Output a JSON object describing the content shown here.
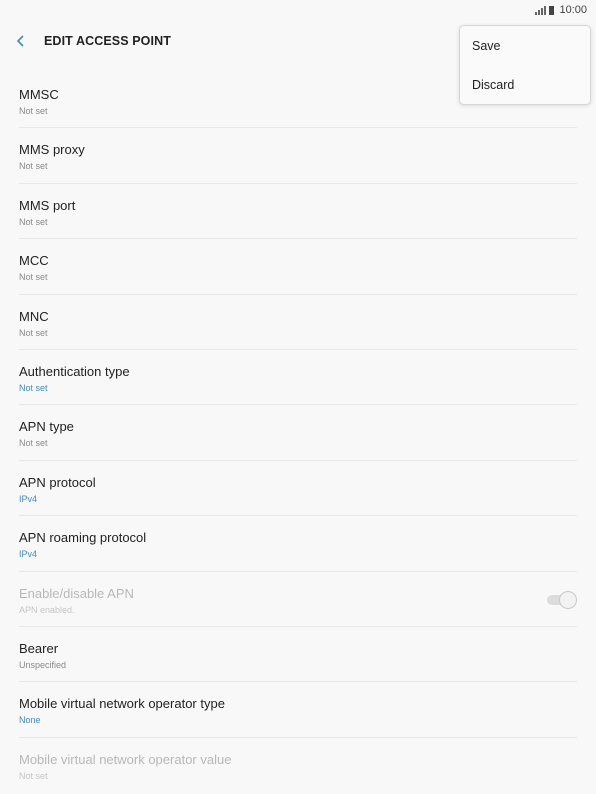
{
  "status_bar": {
    "time": "10:00",
    "icons": [
      "signal-icon",
      "battery-icon"
    ]
  },
  "app_bar": {
    "back_icon": "chevron-left-icon",
    "title": "EDIT ACCESS POINT"
  },
  "menu": {
    "items": [
      "Save",
      "Discard"
    ]
  },
  "colors": {
    "accent": "#3e8cc7",
    "secondary_text": "#8a8a8a",
    "disabled_text": "#b8b8b8",
    "background": "#f8f8f8"
  },
  "settings": [
    {
      "label": "MMSC",
      "value": "Not set"
    },
    {
      "label": "MMS proxy",
      "value": "Not set"
    },
    {
      "label": "MMS port",
      "value": "Not set"
    },
    {
      "label": "MCC",
      "value": "Not set"
    },
    {
      "label": "MNC",
      "value": "Not set"
    },
    {
      "label": "Authentication type",
      "value": "Not set"
    },
    {
      "label": "APN type",
      "value": "Not set"
    },
    {
      "label": "APN protocol",
      "value": "IPv4"
    },
    {
      "label": "APN roaming protocol",
      "value": "IPv4"
    },
    {
      "label": "Enable/disable APN",
      "value": "APN enabled."
    },
    {
      "label": "Bearer",
      "value": "Unspecified"
    },
    {
      "label": "Mobile virtual network operator type",
      "value": "None"
    },
    {
      "label": "Mobile virtual network operator value",
      "value": "Not set"
    }
  ]
}
